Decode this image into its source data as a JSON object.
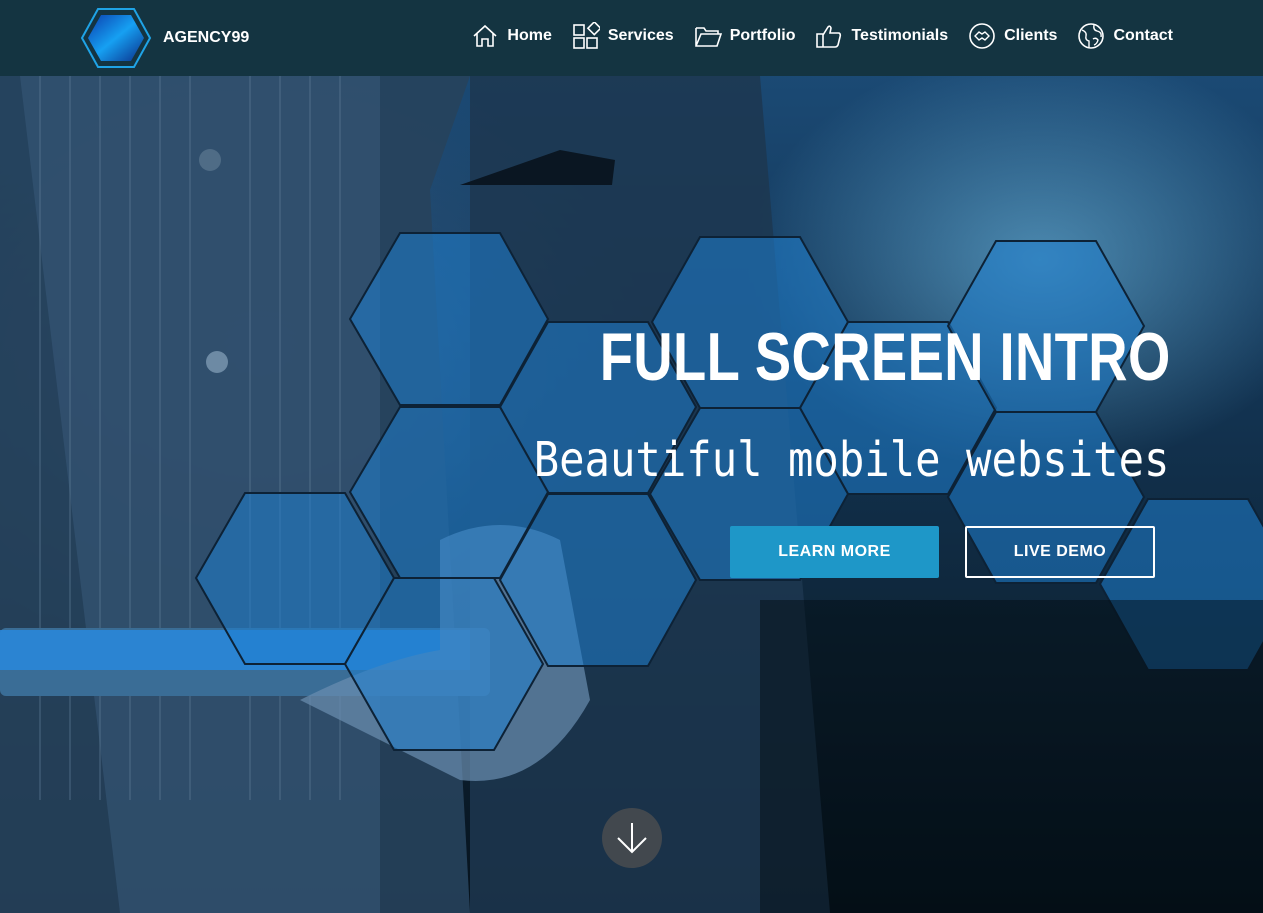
{
  "brand": {
    "name": "AGENCY99",
    "logo": "hexagon-logo"
  },
  "nav": [
    {
      "label": "Home",
      "icon": "home-icon"
    },
    {
      "label": "Services",
      "icon": "services-icon"
    },
    {
      "label": "Portfolio",
      "icon": "folder-icon"
    },
    {
      "label": "Testimonials",
      "icon": "thumbs-up-icon"
    },
    {
      "label": "Clients",
      "icon": "handshake-icon"
    },
    {
      "label": "Contact",
      "icon": "globe-icon"
    }
  ],
  "hero": {
    "title": "FULL SCREEN INTRO",
    "subtitle": "Beautiful mobile websites",
    "primary_button": "LEARN MORE",
    "secondary_button": "LIVE DEMO",
    "scroll_icon": "arrow-down-icon"
  },
  "colors": {
    "navbar": "#143441",
    "accent": "#1e97c8",
    "hexagon": "#1f7fd0"
  }
}
